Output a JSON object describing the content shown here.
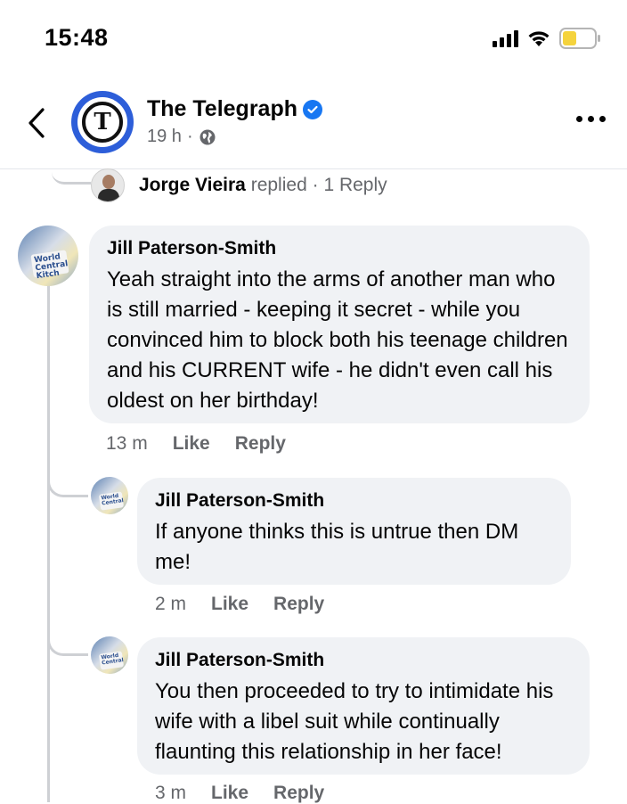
{
  "status_bar": {
    "time": "15:48"
  },
  "header": {
    "page_name": "The Telegraph",
    "time_ago": "19 h",
    "separator": "·",
    "avatar_letter": "T"
  },
  "reply_summary": {
    "name": "Jorge Vieira",
    "action": "replied",
    "separator": "·",
    "count": "1 Reply"
  },
  "comments": [
    {
      "author": "Jill Paterson-Smith",
      "text": "Yeah straight into the arms of another man who is still married - keeping it secret - while you convinced him to block both his teenage children and his CURRENT wife - he didn't even call his oldest on her birthday!",
      "time": "13 m",
      "like": "Like",
      "reply": "Reply"
    },
    {
      "author": "Jill Paterson-Smith",
      "text": "If anyone thinks this is untrue then DM me!",
      "time": "2 m",
      "like": "Like",
      "reply": "Reply"
    },
    {
      "author": "Jill Paterson-Smith",
      "text": "You then proceeded to try to intimidate his wife with a libel suit while continually flaunting this relationship in her face!",
      "time": "3 m",
      "like": "Like",
      "reply": "Reply"
    }
  ],
  "avatar_sign_text": "World Central Kitchen",
  "colors": {
    "verified": "#1877f2",
    "bubble": "#f0f2f5",
    "secondary_text": "#65676b",
    "battery": "#f5d33d"
  }
}
